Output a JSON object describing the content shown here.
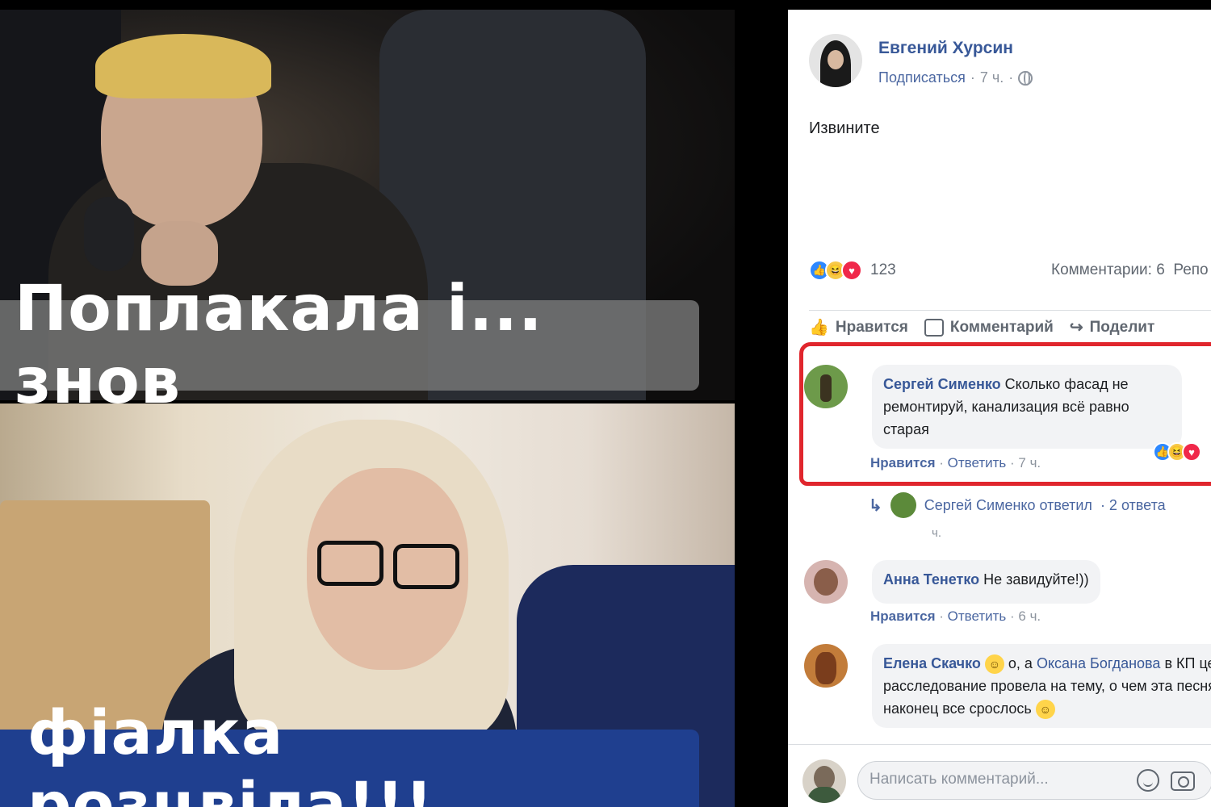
{
  "meme": {
    "caption_top": "Поплакала і... знов",
    "caption_bottom": "фіалка розцвіла!!!"
  },
  "post": {
    "author": "Евгений Хурсин",
    "follow_label": "Подписаться",
    "time": "7 ч.",
    "text": "Извините",
    "reaction_count": "123",
    "comments_label": "Комментарии: 6",
    "reposts_label": "Репо"
  },
  "actions": {
    "like": "Нравится",
    "comment": "Комментарий",
    "share": "Поделит"
  },
  "comments": [
    {
      "name": "Сергей Сименко",
      "text": "Сколько фасад не ремонтируй, канализация всё равно старая",
      "like_label": "Нравится",
      "reply_label": "Ответить",
      "time": "7 ч."
    },
    {
      "name": "Анна Тенетко",
      "text": "Не завидуйте!))",
      "like_label": "Нравится",
      "reply_label": "Ответить",
      "time": "6 ч."
    },
    {
      "name": "Елена Скачко",
      "text_part1": "о, а",
      "mention": "Оксана Богданова",
      "text_part2": "в КП целое расследование провела на тему, о чем эта песня)) наконец все срослось"
    }
  ],
  "reply_thread": {
    "text": "Сергей Сименко ответил",
    "count": "· 2 ответа",
    "time": "ч."
  },
  "composer": {
    "placeholder": "Написать комментарий..."
  },
  "colors": {
    "fb_link": "#385898",
    "highlight_red": "#e0262d",
    "caption_blue": "#1f3f8f"
  }
}
